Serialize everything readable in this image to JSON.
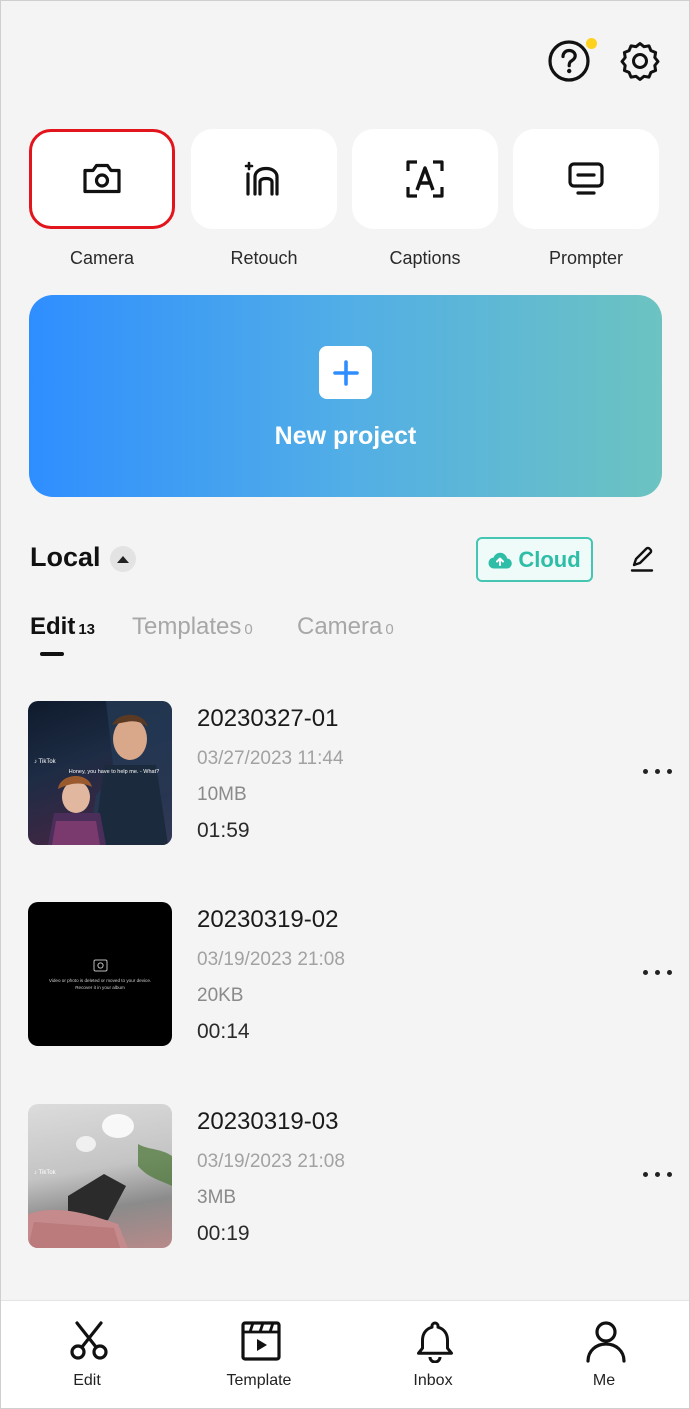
{
  "header": {
    "help_icon": "help-circle-icon",
    "settings_icon": "gear-icon",
    "notification_color": "#ffd21f"
  },
  "tools": [
    {
      "label": "Camera",
      "icon": "camera-icon",
      "selected": true
    },
    {
      "label": "Retouch",
      "icon": "retouch-icon",
      "selected": false
    },
    {
      "label": "Captions",
      "icon": "captions-icon",
      "selected": false
    },
    {
      "label": "Prompter",
      "icon": "prompter-icon",
      "selected": false
    }
  ],
  "new_project": {
    "label": "New project",
    "icon": "plus-icon"
  },
  "local": {
    "title": "Local",
    "cloud_label": "Cloud",
    "tabs": [
      {
        "label": "Edit",
        "count": "13",
        "active": true
      },
      {
        "label": "Templates",
        "count": "0",
        "active": false
      },
      {
        "label": "Camera",
        "count": "0",
        "active": false
      }
    ]
  },
  "projects": [
    {
      "name": "20230327-01",
      "date": "03/27/2023 11:44",
      "size": "10MB",
      "duration": "01:59"
    },
    {
      "name": "20230319-02",
      "date": "03/19/2023 21:08",
      "size": "20KB",
      "duration": "00:14"
    },
    {
      "name": "20230319-03",
      "date": "03/19/2023 21:08",
      "size": "3MB",
      "duration": "00:19"
    }
  ],
  "thumbnails": {
    "caption_1": "Honey, you have to help me. - What?",
    "caption_2_line1": "Video or photo is deleted or moved to your device.",
    "caption_2_line2": "Recover it in your album",
    "watermark": "TikTok"
  },
  "bottom_nav": [
    {
      "label": "Edit",
      "icon": "scissors-icon"
    },
    {
      "label": "Template",
      "icon": "template-clapper-icon"
    },
    {
      "label": "Inbox",
      "icon": "bell-icon"
    },
    {
      "label": "Me",
      "icon": "person-icon"
    }
  ],
  "colors": {
    "accent_red": "#e2141c",
    "cloud_teal": "#2ebda6",
    "banner_start": "#2f8eff",
    "banner_end": "#6cc3c1"
  }
}
